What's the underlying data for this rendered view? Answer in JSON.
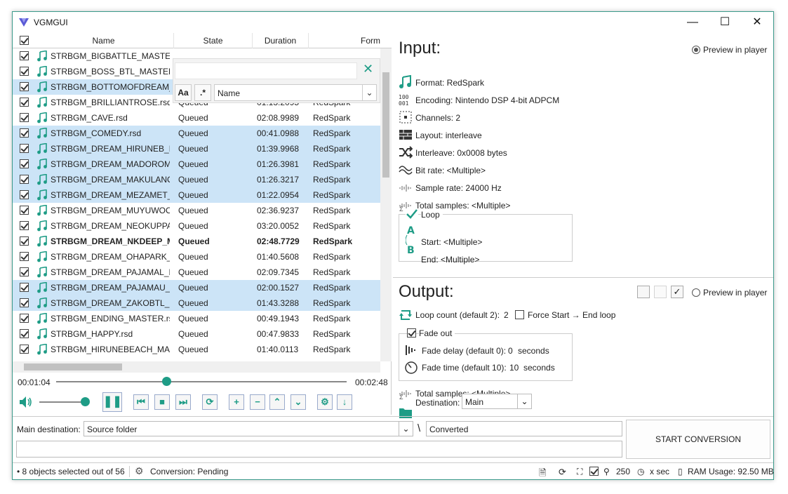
{
  "window": {
    "title": "VGMGUI"
  },
  "grid": {
    "columns": [
      "Name",
      "State",
      "Duration",
      "Form"
    ],
    "rows": [
      {
        "name": "STRBGM_BIGBATTLE_MASTER.rsd",
        "state": "",
        "duration": "",
        "format": "",
        "selected": false,
        "bold": false
      },
      {
        "name": "STRBGM_BOSS_BTL_MASTER.rsd",
        "state": "",
        "duration": "",
        "format": "",
        "selected": false,
        "bold": false
      },
      {
        "name": "STRBGM_BOTTOMOFDREAM_MASTER.rsd",
        "state": "",
        "duration": "",
        "format": "",
        "selected": true,
        "bold": false
      },
      {
        "name": "STRBGM_BRILLIANTROSE.rsd",
        "state": "Queued",
        "duration": "01:13.2095",
        "format": "RedSpark",
        "selected": false,
        "bold": false
      },
      {
        "name": "STRBGM_CAVE.rsd",
        "state": "Queued",
        "duration": "02:08.9989",
        "format": "RedSpark",
        "selected": false,
        "bold": false
      },
      {
        "name": "STRBGM_COMEDY.rsd",
        "state": "Queued",
        "duration": "00:41.0988",
        "format": "RedSpark",
        "selected": true,
        "bold": false
      },
      {
        "name": "STRBGM_DREAM_HIRUNEB_MASTER.rsd",
        "state": "Queued",
        "duration": "01:39.9968",
        "format": "RedSpark",
        "selected": true,
        "bold": false
      },
      {
        "name": "STRBGM_DREAM_MADOROMI_MASTER.rsd",
        "state": "Queued",
        "duration": "01:26.3981",
        "format": "RedSpark",
        "selected": true,
        "bold": false
      },
      {
        "name": "STRBGM_DREAM_MAKULANO_MASTER.rsd",
        "state": "Queued",
        "duration": "01:26.3217",
        "format": "RedSpark",
        "selected": true,
        "bold": false
      },
      {
        "name": "STRBGM_DREAM_MEZAMET_MASTER.rsd",
        "state": "Queued",
        "duration": "01:22.0954",
        "format": "RedSpark",
        "selected": true,
        "bold": false
      },
      {
        "name": "STRBGM_DREAM_MUYUWOOD_MASTER.rsd",
        "state": "Queued",
        "duration": "02:36.9237",
        "format": "RedSpark",
        "selected": false,
        "bold": false
      },
      {
        "name": "STRBGM_DREAM_NEOKUPPA_MASTER.rsd",
        "state": "Queued",
        "duration": "03:20.0052",
        "format": "RedSpark",
        "selected": false,
        "bold": false
      },
      {
        "name": "STRBGM_DREAM_NKDEEP_MASTER.rsd",
        "state": "Queued",
        "duration": "02:48.7729",
        "format": "RedSpark",
        "selected": false,
        "bold": true
      },
      {
        "name": "STRBGM_DREAM_OHAPARK_MASTER.rsd",
        "state": "Queued",
        "duration": "01:40.5608",
        "format": "RedSpark",
        "selected": false,
        "bold": false
      },
      {
        "name": "STRBGM_DREAM_PAJAMAL_MASTER.rsd",
        "state": "Queued",
        "duration": "02:09.7345",
        "format": "RedSpark",
        "selected": false,
        "bold": false
      },
      {
        "name": "STRBGM_DREAM_PAJAMAU_MASTER.rsd",
        "state": "Queued",
        "duration": "02:00.1527",
        "format": "RedSpark",
        "selected": true,
        "bold": false
      },
      {
        "name": "STRBGM_DREAM_ZAKOBTL_MASTER.rsd",
        "state": "Queued",
        "duration": "01:43.3288",
        "format": "RedSpark",
        "selected": true,
        "bold": false
      },
      {
        "name": "STRBGM_ENDING_MASTER.rsd",
        "state": "Queued",
        "duration": "00:49.1943",
        "format": "RedSpark",
        "selected": false,
        "bold": false
      },
      {
        "name": "STRBGM_HAPPY.rsd",
        "state": "Queued",
        "duration": "00:47.9833",
        "format": "RedSpark",
        "selected": false,
        "bold": false
      },
      {
        "name": "STRBGM_HIRUNEBEACH_MASTER.rsd",
        "state": "Queued",
        "duration": "01:40.0113",
        "format": "RedSpark",
        "selected": false,
        "bold": false
      }
    ]
  },
  "filter": {
    "text": "",
    "case_label": "Aa",
    "regex_label": ".*",
    "field": "Name"
  },
  "player": {
    "position": "00:01:04",
    "length": "00:02:48",
    "progress": 0.38,
    "volume": 1.0
  },
  "input": {
    "title": "Input:",
    "preview_label": "Preview in player",
    "format": "Format:  RedSpark",
    "encoding": "Encoding:  Nintendo DSP 4-bit ADPCM",
    "channels": "Channels:  2",
    "layout": "Layout:  interleave",
    "interleave": "Interleave:  0x0008 bytes",
    "bitrate": "Bit rate:  <Multiple>",
    "samplerate": "Sample rate:  24000 Hz",
    "totalsamples": "Total samples:  <Multiple>",
    "loop_label": "Loop",
    "loop_start": "Start:  <Multiple>",
    "loop_end": "End:  <Multiple>"
  },
  "output": {
    "title": "Output:",
    "preview_label": "Preview in player",
    "loopcount_label": "Loop count (default 2):",
    "loopcount_value": "2",
    "force_label": "Force Start → End loop",
    "fadeout_label": "Fade out",
    "fadedelay_label": "Fade delay (default 0):",
    "fadedelay_value": "0",
    "fadetime_label": "Fade time (default 10):",
    "fadetime_value": "10",
    "seconds": "seconds",
    "totalsamples": "Total samples:  <Multiple>",
    "destination_label": "Destination:",
    "destination_value": "Main"
  },
  "bottom": {
    "main_dest_label": "Main destination:",
    "main_dest_value": "Source folder",
    "sep": "\\",
    "subfolder": "Converted",
    "start_label": "START CONVERSION"
  },
  "status": {
    "selection": "8 objects selected out of 56",
    "conversion": "Conversion:  Pending",
    "zoom": "250",
    "time": "x sec",
    "ram": "RAM Usage: 92.50 MB"
  },
  "colors": {
    "accent": "#1e9c86",
    "selection": "#cce4f7"
  }
}
